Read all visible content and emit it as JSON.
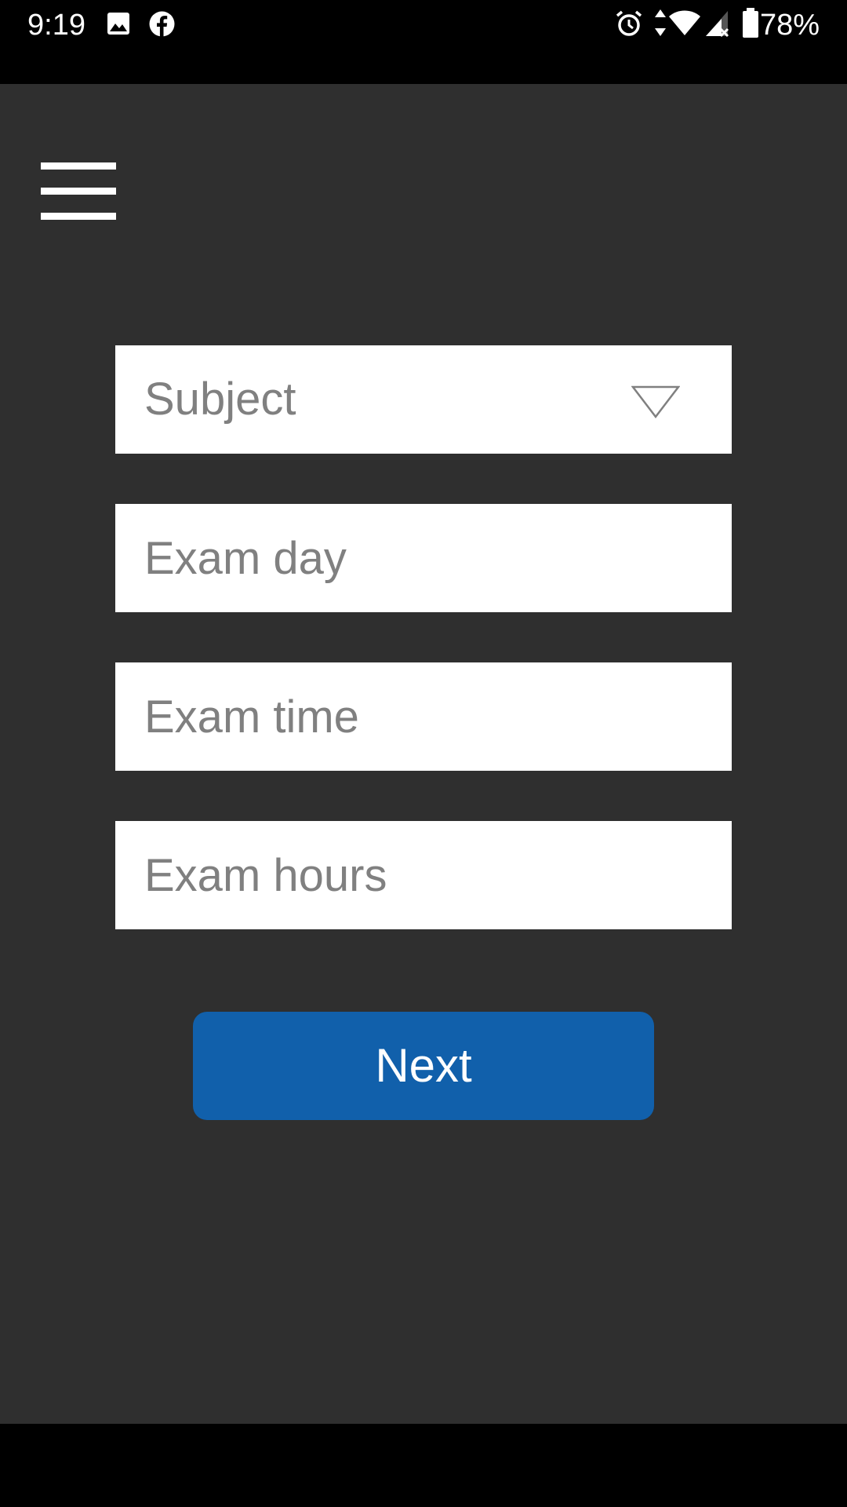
{
  "status_bar": {
    "time": "9:19",
    "battery_percent": "78%",
    "icons": [
      "image-icon",
      "facebook-icon",
      "alarm-icon",
      "data-arrows-icon",
      "wifi-icon",
      "signal-icon",
      "battery-icon"
    ]
  },
  "form": {
    "subject": {
      "value": "Subject",
      "icon": "dropdown-triangle-icon"
    },
    "exam_day": {
      "placeholder": "Exam day"
    },
    "exam_time": {
      "placeholder": "Exam time"
    },
    "exam_hours": {
      "placeholder": "Exam hours"
    },
    "next_label": "Next"
  },
  "colors": {
    "background": "#2f2f2f",
    "field": "#ffffff",
    "placeholder": "#808080",
    "accent": "#1160ab"
  }
}
